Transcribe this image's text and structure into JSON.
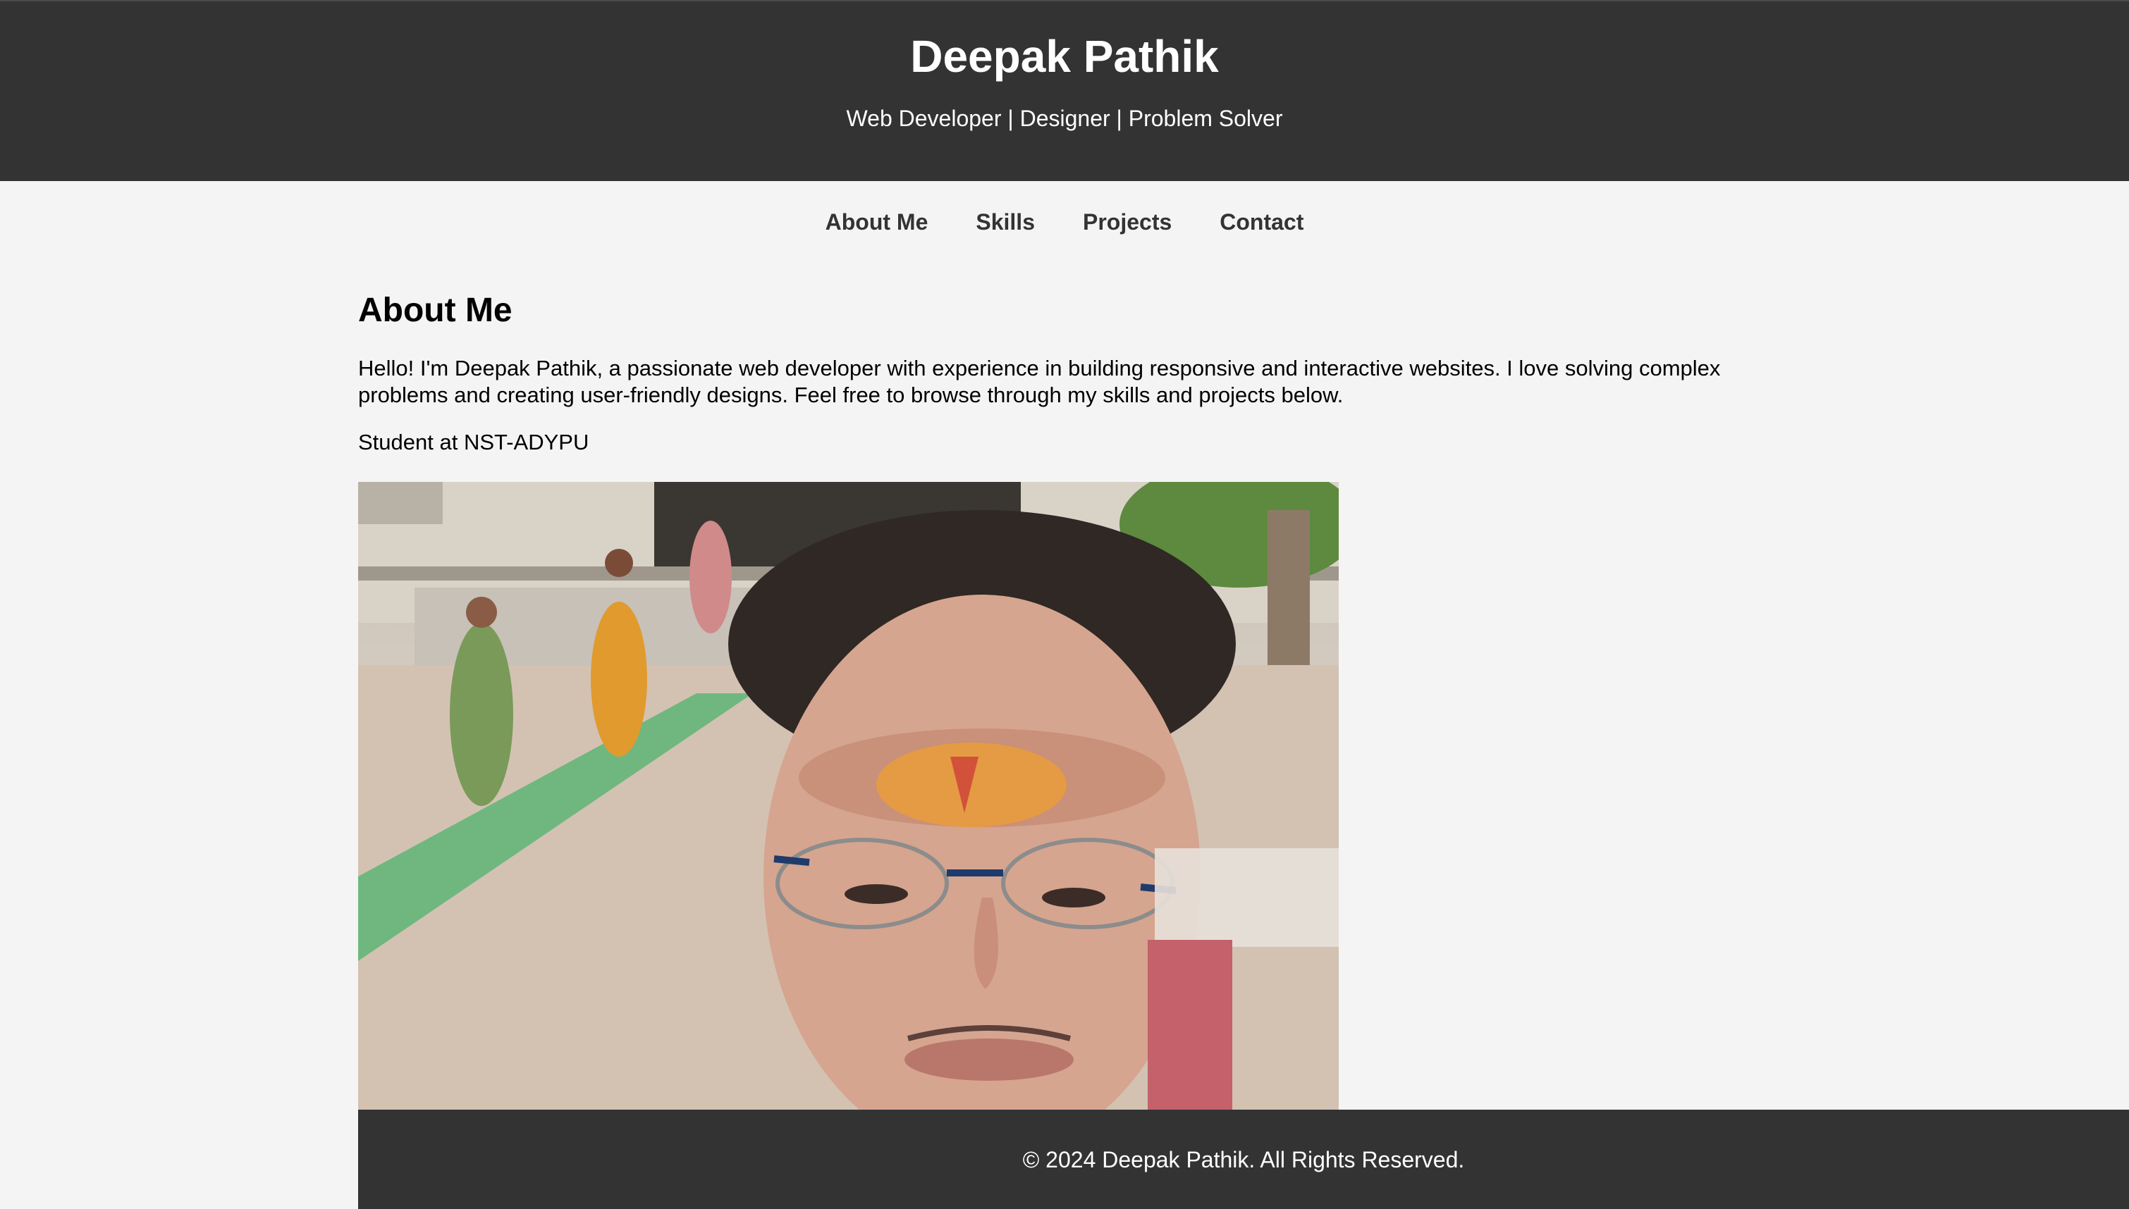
{
  "header": {
    "title": "Deepak Pathik",
    "tagline": "Web Developer | Designer | Problem Solver"
  },
  "nav": {
    "items": [
      {
        "label": "About Me"
      },
      {
        "label": "Skills"
      },
      {
        "label": "Projects"
      },
      {
        "label": "Contact"
      }
    ]
  },
  "about": {
    "heading": "About Me",
    "intro": "Hello! I'm Deepak Pathik, a passionate web developer with experience in building responsive and interactive websites. I love solving complex problems and creating user-friendly designs. Feel free to browse through my skills and projects below.",
    "student": "Student at NST-ADYPU"
  },
  "photo": {
    "icon": "profile-photo"
  },
  "footer": {
    "text": "© 2024 Deepak Pathik. All Rights Reserved."
  },
  "colors": {
    "header_bg": "#333333",
    "page_bg": "#f4f4f4",
    "nav_text": "#333333",
    "footer_bg": "#333333"
  }
}
